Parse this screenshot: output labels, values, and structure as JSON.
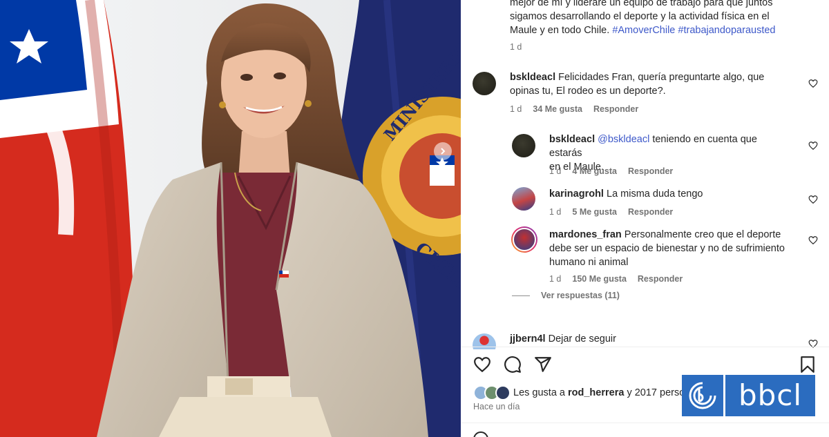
{
  "caption": {
    "lines": [
      "mejor de mí y lideraré un equipo de trabajo para que juntos",
      "sigamos desarrollando el deporte y la actividad física en el",
      "Maule y en todo Chile."
    ],
    "hashtags": "#AmoverChile #trabajandoparausted",
    "time": "1 d"
  },
  "comments": [
    {
      "username": "bskldeacl",
      "text_line1": "Felicidades Fran, quería preguntarte algo, que",
      "text_line2": "opinas tu, El rodeo es un deporte?.",
      "time": "1 d",
      "likes": "34 Me gusta",
      "reply": "Responder"
    },
    {
      "username": "bskldeacl",
      "mention": "@bskldeacl",
      "text_line1": "teniendo en cuenta que estarás",
      "text_line2": "en el Maule.",
      "time": "1 d",
      "likes": "4 Me gusta",
      "reply": "Responder"
    },
    {
      "username": "karinagrohl",
      "text_line1": "La misma duda tengo",
      "time": "1 d",
      "likes": "5 Me gusta",
      "reply": "Responder"
    },
    {
      "username": "mardones_fran",
      "text_line1": "Personalmente creo que el deporte",
      "text_line2": "debe ser un espacio de bienestar y no de sufrimiento",
      "text_line3": "humano ni animal",
      "time": "1 d",
      "likes": "150 Me gusta",
      "reply": "Responder"
    },
    {
      "username": "jjbern4l",
      "text_line1": "Dejar de seguir"
    }
  ],
  "view_replies": "Ver respuestas (11)",
  "likes_bar": {
    "prefix": "Les gusta a",
    "user": "rod_herrera",
    "suffix": "y 2017 perso"
  },
  "time_ago": "Hace un día",
  "logo": {
    "word": "bbcl"
  },
  "photo": {
    "seal_text_1": "MINISTERIO DE",
    "seal_text_2": "CHILE"
  },
  "colors": {
    "link": "#3d58c9",
    "muted": "#737373",
    "brand": "#2b6cbf",
    "flag_red": "#d52b1e",
    "flag_blue": "#0039a6",
    "banner_navy": "#1f2a6e"
  },
  "icons": [
    "chevron-right-icon",
    "heart-icon",
    "comment-icon",
    "share-icon",
    "bookmark-icon",
    "bbcl-logo-mark"
  ]
}
